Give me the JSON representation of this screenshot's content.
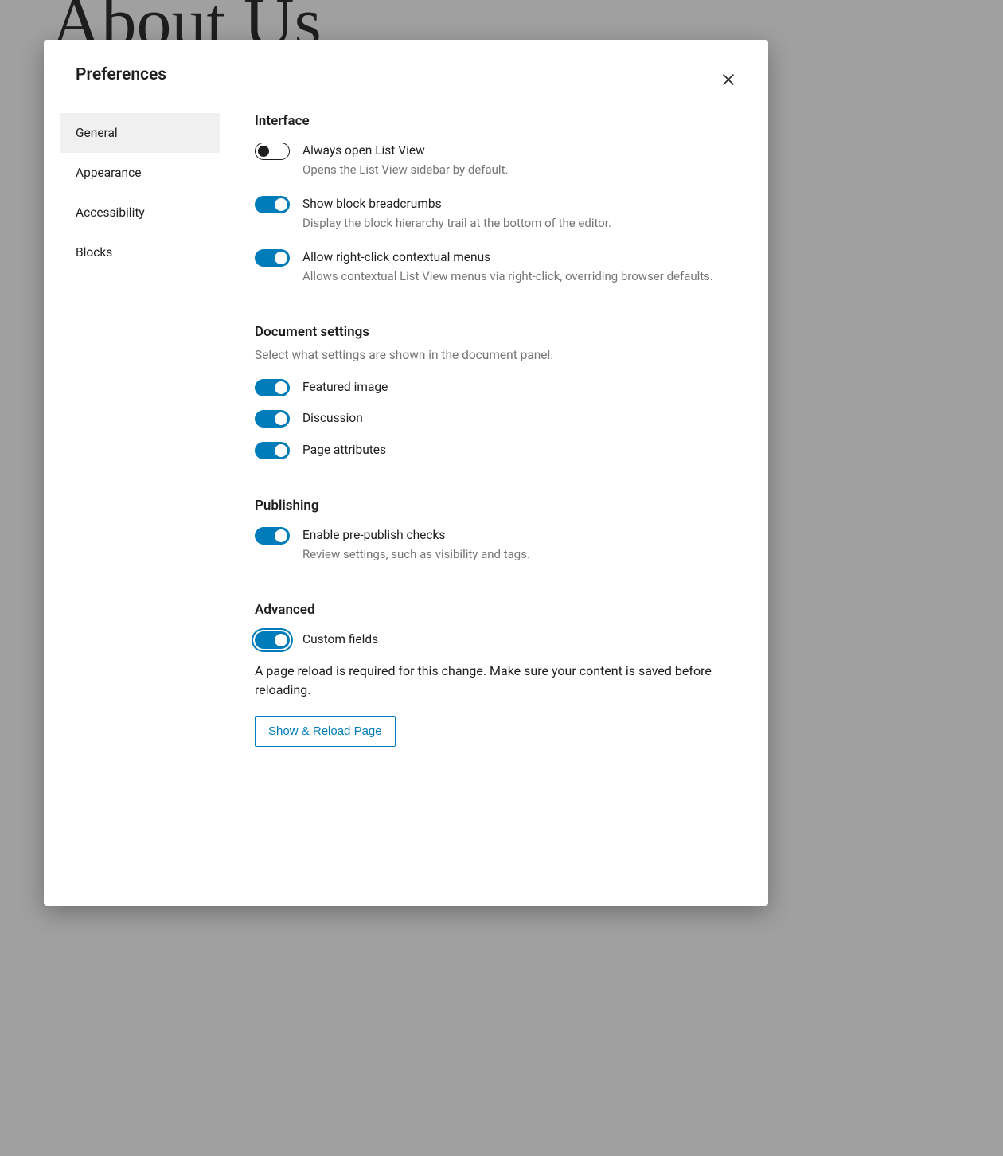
{
  "background": {
    "heading": "About Us"
  },
  "modal": {
    "title": "Preferences"
  },
  "tabs": [
    {
      "label": "General",
      "active": true
    },
    {
      "label": "Appearance",
      "active": false
    },
    {
      "label": "Accessibility",
      "active": false
    },
    {
      "label": "Blocks",
      "active": false
    }
  ],
  "sections": {
    "interface": {
      "title": "Interface",
      "items": [
        {
          "label": "Always open List View",
          "hint": "Opens the List View sidebar by default.",
          "on": false
        },
        {
          "label": "Show block breadcrumbs",
          "hint": "Display the block hierarchy trail at the bottom of the editor.",
          "on": true
        },
        {
          "label": "Allow right-click contextual menus",
          "hint": "Allows contextual List View menus via right-click, overriding browser defaults.",
          "on": true
        }
      ]
    },
    "document": {
      "title": "Document settings",
      "desc": "Select what settings are shown in the document panel.",
      "items": [
        {
          "label": "Featured image",
          "on": true
        },
        {
          "label": "Discussion",
          "on": true
        },
        {
          "label": "Page attributes",
          "on": true
        }
      ]
    },
    "publishing": {
      "title": "Publishing",
      "items": [
        {
          "label": "Enable pre-publish checks",
          "hint": "Review settings, such as visibility and tags.",
          "on": true
        }
      ]
    },
    "advanced": {
      "title": "Advanced",
      "custom_fields": {
        "label": "Custom fields",
        "on": true,
        "focused": true
      },
      "notice": "A page reload is required for this change. Make sure your content is saved before reloading.",
      "button": "Show & Reload Page"
    }
  }
}
